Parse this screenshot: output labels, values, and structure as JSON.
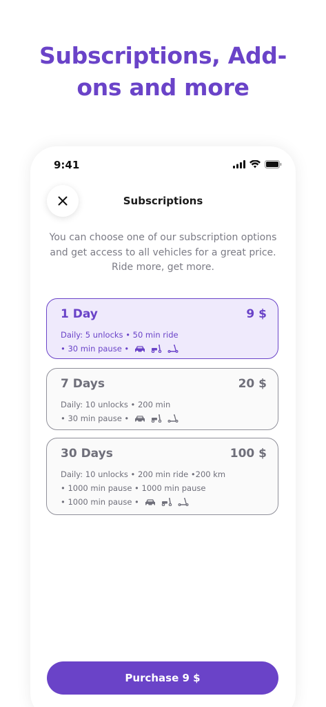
{
  "headline": {
    "line1": "Subscriptions, Add-",
    "line2": "ons and more"
  },
  "status_bar": {
    "time": "9:41",
    "icons": [
      "signal-icon",
      "wifi-icon",
      "battery-icon"
    ]
  },
  "screen": {
    "title": "Subscriptions",
    "close_icon": "close-icon",
    "description": "You can choose one of our subscription options and get access to all vehicles for a great price. Ride more, get more."
  },
  "plans": [
    {
      "name": "1 Day",
      "price": "9 $",
      "selected": true,
      "lines": [
        "Daily: 5 unlocks  • 50 min ride",
        "• 30 min pause •"
      ]
    },
    {
      "name": "7 Days",
      "price": "20 $",
      "selected": false,
      "lines": [
        "Daily: 10 unlocks • 200 min",
        "• 30 min pause •"
      ]
    },
    {
      "name": "30 Days",
      "price": "100 $",
      "selected": false,
      "lines": [
        "Daily: 10 unlocks • 200 min ride  •200 km",
        "• 1000 min pause • 1000 min pause",
        "• 1000 min pause •"
      ]
    }
  ],
  "vehicle_icons": [
    "car-icon",
    "moped-icon",
    "scooter-icon"
  ],
  "colors": {
    "accent": "#6a43c8",
    "selected_bg": "#efeafc",
    "muted_text": "#6f6f7a"
  },
  "purchase_button": {
    "label": "Purchase 9 $"
  }
}
